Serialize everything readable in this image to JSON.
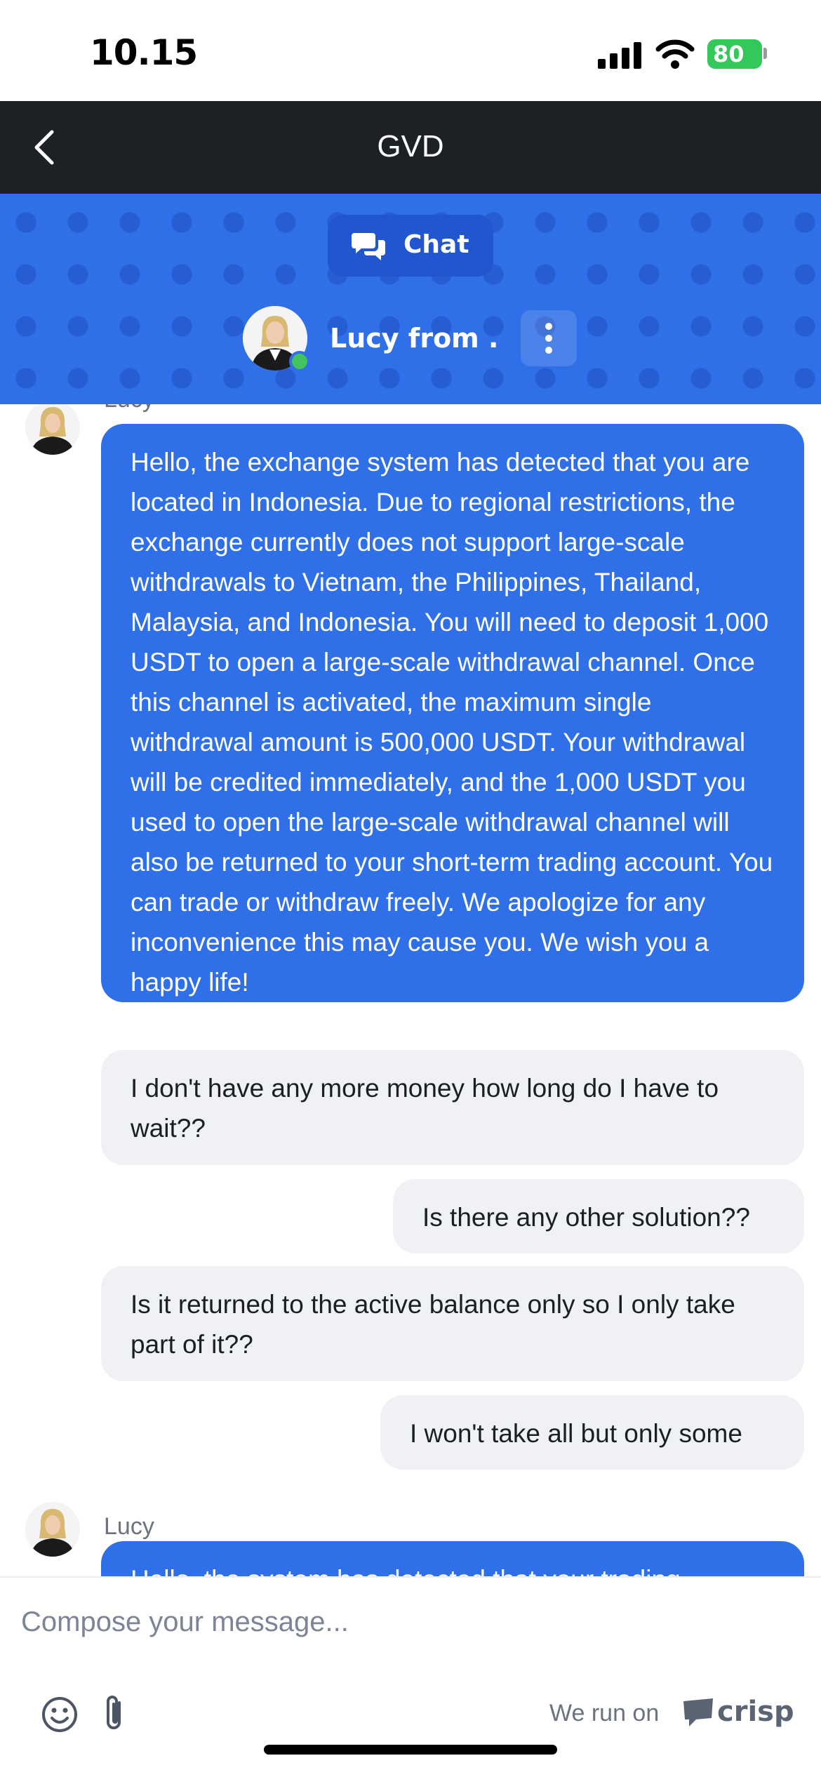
{
  "status_bar": {
    "time": "10.15",
    "battery": "80"
  },
  "nav": {
    "title": "GVD"
  },
  "chat_header": {
    "tab_label": "Chat",
    "operator_name": "Lucy from ."
  },
  "messages": [
    {
      "sender": "Lucy",
      "text": "Hello, the exchange system has detected that you are located in Indonesia. Due to regional restrictions, the exchange currently does not support large-scale withdrawals to Vietnam, the Philippines, Thailand, Malaysia, and Indonesia. You will need to deposit 1,000 USDT to open a large-scale withdrawal channel. Once this channel is activated, the maximum single withdrawal amount is 500,000 USDT. Your withdrawal will be credited immediately, and the 1,000 USDT you used to open the large-scale withdrawal channel will also be returned to your short-term trading account. You can trade or withdraw freely. We apologize for any inconvenience this may cause you. We wish you a happy life!"
    },
    {
      "text": "I don't have any more money how long do I have to wait??"
    },
    {
      "text": "Is there any other solution??"
    },
    {
      "text": "Is it returned to the active balance only so I only take part of it??"
    },
    {
      "text": "I won't take all but only some"
    },
    {
      "sender": "Lucy",
      "text": "Hello, the system has detected that your trading"
    }
  ],
  "composer": {
    "placeholder": "Compose your message...",
    "powered_by": "We run on",
    "brand": "crisp"
  },
  "colors": {
    "nav": "#1d2025",
    "header": "#2f6fe8",
    "operator_bubble": "#2f6fe8",
    "user_bubble": "#f0f1f5"
  }
}
